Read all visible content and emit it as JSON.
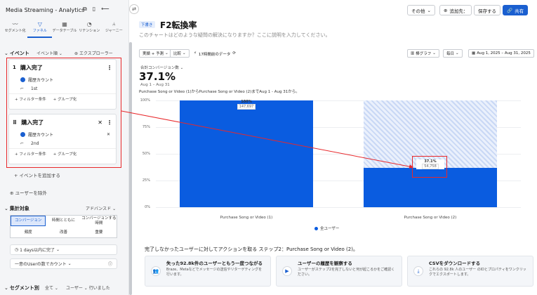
{
  "app": {
    "title": "Media Streaming - Analytics"
  },
  "toolbar": {
    "items": [
      {
        "label": "セグメント化",
        "icon": "trend-icon"
      },
      {
        "label": "ファネル",
        "icon": "funnel-icon"
      },
      {
        "label": "データテーブル",
        "icon": "table-icon"
      },
      {
        "label": "リテンション",
        "icon": "retention-icon"
      },
      {
        "label": "ジャーニー",
        "icon": "journey-icon"
      }
    ]
  },
  "events_section": {
    "title": "イベント",
    "order_label": "イベント順",
    "explorer": "エクスプローラー"
  },
  "events": [
    {
      "num": "1",
      "name": "購入完了",
      "metric": "履歴カウント",
      "ordinal": "1st",
      "add_filter": "+ フィルター条件",
      "group": "+ グループ化"
    },
    {
      "num": "",
      "name": "購入完了",
      "metric": "履歴カウント",
      "ordinal": "2nd",
      "add_filter": "+ フィルター条件",
      "group": "+ グループ化"
    }
  ],
  "add_event": "+ イベントを追加する",
  "exclude_users": "ユーザーを除外",
  "measure": {
    "title": "集計対象",
    "advanced": "アドバンスド",
    "options": [
      "コンバージョン",
      "時間とともに",
      "コンバージョンする時間",
      "頻度",
      "改善",
      "重要"
    ],
    "window": "1 days以内に完了",
    "count": "一意のUserの数でカウント"
  },
  "segment": {
    "title": "セグメント別",
    "all": "全て",
    "users": "ユーザー",
    "users_suffix": "行いました"
  },
  "header": {
    "other": "その他",
    "add_to": "追加先：",
    "save": "保存する",
    "share": "共有"
  },
  "chart_meta": {
    "badge": "下書き",
    "title": "F2転換率",
    "desc": "このチャートはどのような疑問の解決になりますか？ここに説明を入力してください。"
  },
  "controls": {
    "actual_vs_forecast": "実績 + 予測",
    "compare": "比較",
    "data_age": "17時間前のデータ",
    "chart_type": "棒グラフ",
    "interval": "毎日",
    "date_range": "Aug 1, 2025 – Aug 31, 2025"
  },
  "summary": {
    "label": "合計コンバージョン数",
    "value": "37.1%",
    "range": "Aug 1 – Aug 31",
    "sentence": "Purchase Song or Video (1)からPurchase Song or Video (2)までAug 1 - Aug 31から。"
  },
  "chart_data": {
    "type": "bar",
    "categories": [
      "Purchase Song or Video (1)",
      "Purchase Song or Video (2)"
    ],
    "series": [
      {
        "name": "全ユーザー",
        "values": [
          100,
          37.1
        ],
        "counts": [
          "147,697",
          "54,758"
        ],
        "labels": [
          "100%",
          "37.1%"
        ]
      }
    ],
    "ylim": [
      0,
      100
    ],
    "yticks": [
      "0%",
      "25%",
      "50%",
      "75%",
      "100%"
    ],
    "color": "#0a5ce0"
  },
  "bottom": {
    "title": "完了しなかったユーザーに対してアクションを取る ステップ2：Purchase Song or Video (2)。",
    "cards": [
      {
        "title": "失った92.8k件のユーザーともう一度つながる",
        "desc": "Braze、Metaなどでメッセージの送信やリターゲティングを行います。",
        "icon": "users-icon"
      },
      {
        "title": "ユーザーの履歴を観察する",
        "desc": "ユーザーがステップ2を完了しないと何が起こるかをご確認ください。",
        "icon": "play-icon"
      },
      {
        "title": "CSVをダウンロードする",
        "desc": "これらの 92.8k 人のユーザー のIDとプロパティをワンクリックでエクスポートします。",
        "icon": "download-icon"
      }
    ]
  }
}
